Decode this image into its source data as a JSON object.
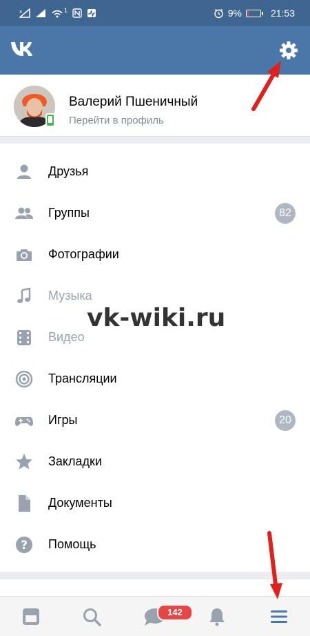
{
  "status_bar": {
    "time": "21:53",
    "battery": "9%",
    "sim": "1"
  },
  "header": {
    "logo": "VK"
  },
  "profile": {
    "name": "Валерий Пшеничный",
    "subtitle": "Перейти в профиль",
    "online_status": "mobile"
  },
  "menu": {
    "items": [
      {
        "label": "Друзья",
        "icon": "user-icon",
        "enabled": true
      },
      {
        "label": "Группы",
        "icon": "users-icon",
        "badge": "82",
        "enabled": true
      },
      {
        "label": "Фотографии",
        "icon": "camera-icon",
        "enabled": true
      },
      {
        "label": "Музыка",
        "icon": "music-icon",
        "enabled": false
      },
      {
        "label": "Видео",
        "icon": "video-icon",
        "enabled": false
      },
      {
        "label": "Трансляции",
        "icon": "broadcast-icon",
        "enabled": true
      },
      {
        "label": "Игры",
        "icon": "gamepad-icon",
        "badge": "20",
        "enabled": true
      },
      {
        "label": "Закладки",
        "icon": "star-icon",
        "enabled": true
      },
      {
        "label": "Документы",
        "icon": "document-icon",
        "enabled": true
      },
      {
        "label": "Помощь",
        "icon": "help-icon",
        "enabled": true
      }
    ]
  },
  "tabbar": {
    "messages_badge": "142",
    "tabs": [
      "news-icon",
      "search-icon",
      "messages-icon",
      "notifications-icon",
      "menu-icon"
    ]
  },
  "watermark": "vk-wiki.ru",
  "colors": {
    "header": "#4a76a8",
    "status_bar": "#3f6591",
    "badge_gray": "#aeb7c2",
    "badge_red": "#e64646",
    "icon_gray": "#99a2ad",
    "annotation_arrow": "#e0201c"
  }
}
